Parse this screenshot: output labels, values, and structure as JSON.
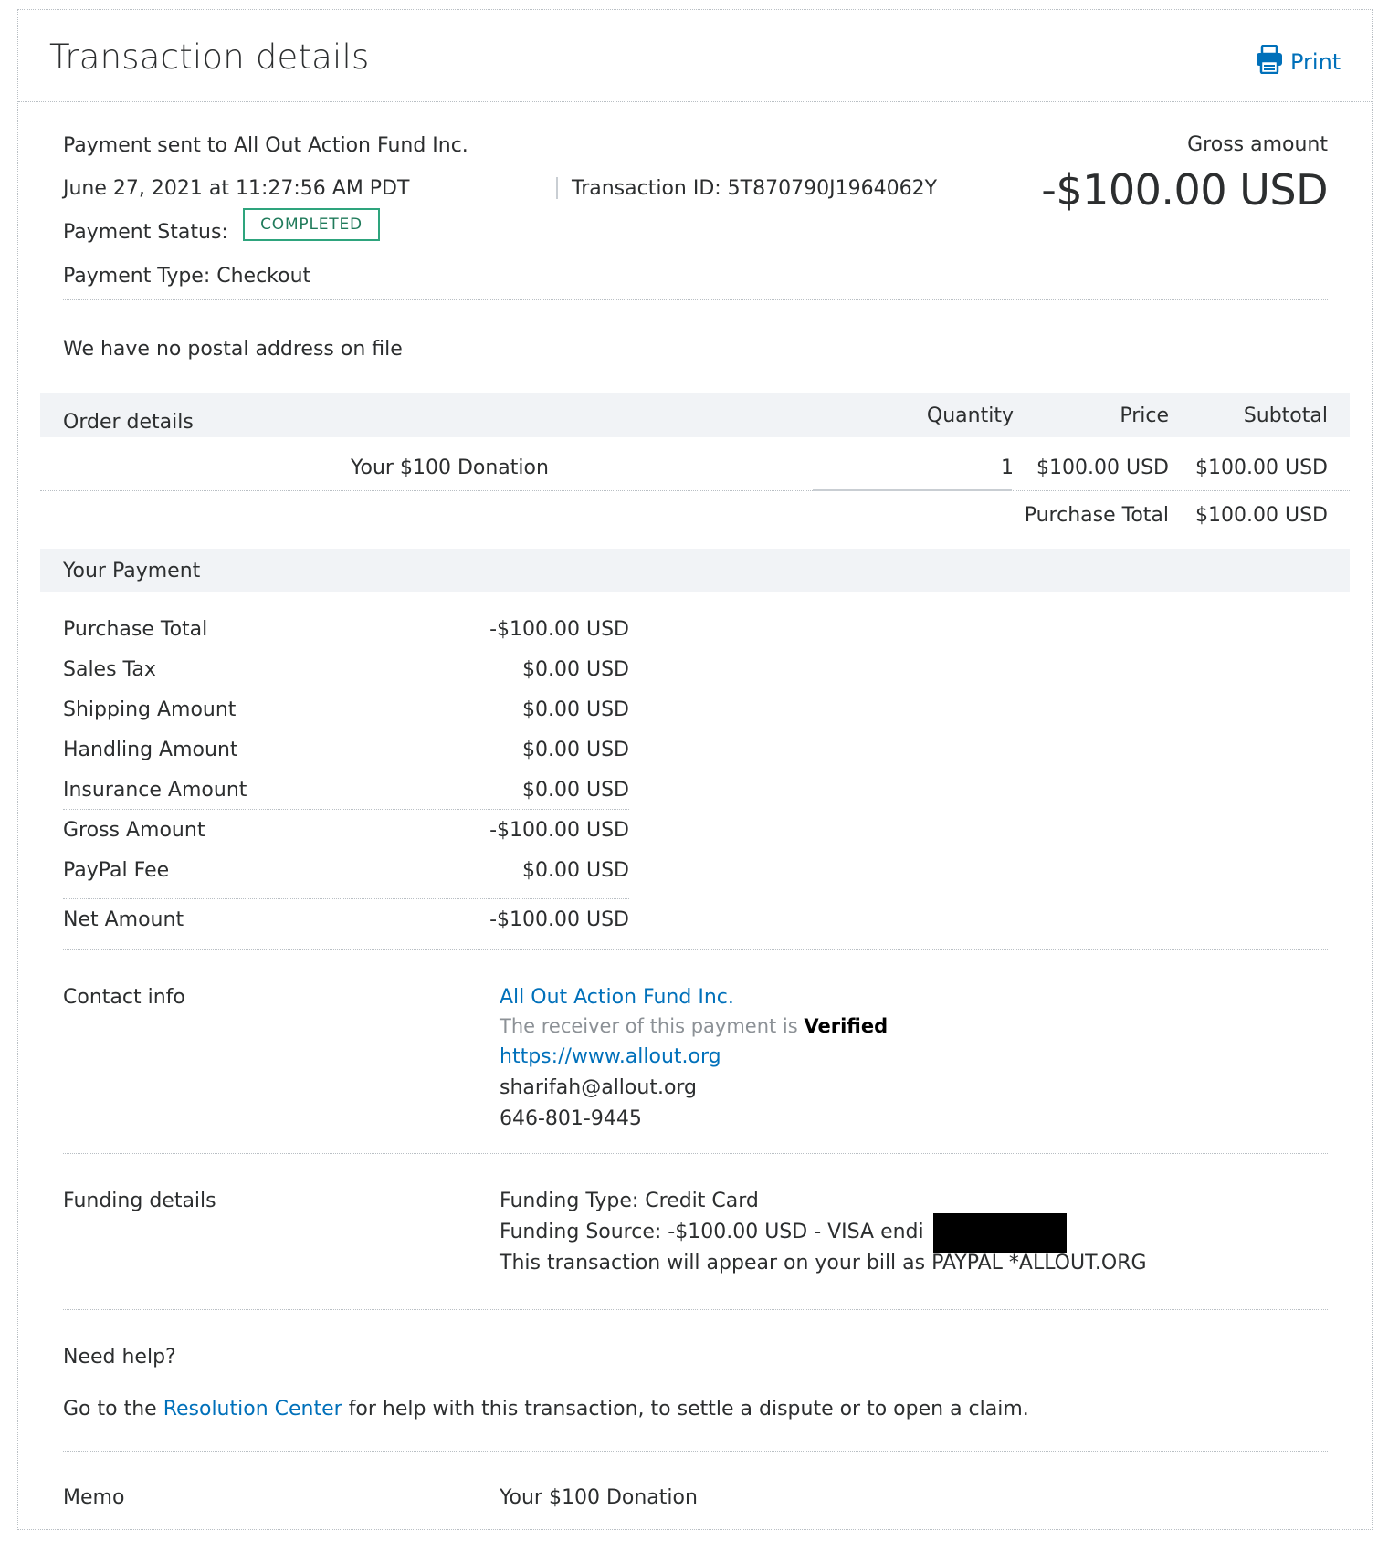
{
  "header": {
    "title": "Transaction details",
    "print_label": "Print"
  },
  "summary": {
    "payment_sent_to": "Payment sent to All Out Action Fund Inc.",
    "datetime": "June 27, 2021 at 11:27:56 AM PDT",
    "transaction_id": "Transaction ID: 5T870790J1964062Y",
    "status_label": "Payment Status:",
    "status_value": "COMPLETED",
    "payment_type": "Payment Type: Checkout",
    "gross_label": "Gross amount",
    "gross_amount": "-$100.00 USD"
  },
  "address": {
    "text": "We have no postal address on file"
  },
  "order": {
    "title": "Order details",
    "col_quantity": "Quantity",
    "col_price": "Price",
    "col_subtotal": "Subtotal",
    "item": {
      "name": "Your $100 Donation",
      "quantity": "1",
      "price": "$100.00 USD",
      "subtotal": "$100.00 USD"
    },
    "total_label": "Purchase Total",
    "total_value": "$100.00 USD"
  },
  "payment": {
    "title": "Your Payment",
    "rows": [
      {
        "label": "Purchase Total",
        "value": "-$100.00 USD"
      },
      {
        "label": "Sales Tax",
        "value": "$0.00 USD"
      },
      {
        "label": "Shipping Amount",
        "value": "$0.00 USD"
      },
      {
        "label": "Handling Amount",
        "value": "$0.00 USD"
      },
      {
        "label": "Insurance Amount",
        "value": "$0.00 USD"
      },
      {
        "label": "Gross Amount",
        "value": "-$100.00 USD"
      },
      {
        "label": "PayPal Fee",
        "value": "$0.00 USD"
      },
      {
        "label": "Net Amount",
        "value": "-$100.00 USD"
      }
    ]
  },
  "contact": {
    "label": "Contact info",
    "name": "All Out Action Fund Inc.",
    "verified_prefix": "The receiver of this payment is",
    "verified_word": "Verified",
    "website": "https://www.allout.org",
    "email": "sharifah@allout.org",
    "phone": "646-801-9445"
  },
  "funding": {
    "label": "Funding details",
    "type": "Funding Type: Credit Card",
    "source": "Funding Source: -$100.00 USD - VISA endi",
    "bill_note": "This transaction will appear on your bill as PAYPAL *ALLOUT.ORG"
  },
  "help": {
    "title": "Need help?",
    "text_before": "Go to the",
    "link": "Resolution Center",
    "text_after": "for help with this transaction, to settle a dispute or to open a claim."
  },
  "memo": {
    "label": "Memo",
    "value": "Your $100 Donation"
  },
  "colors": {
    "accent": "#0070ba",
    "status_green": "#2ea47d",
    "band_bg": "#f1f3f6"
  }
}
